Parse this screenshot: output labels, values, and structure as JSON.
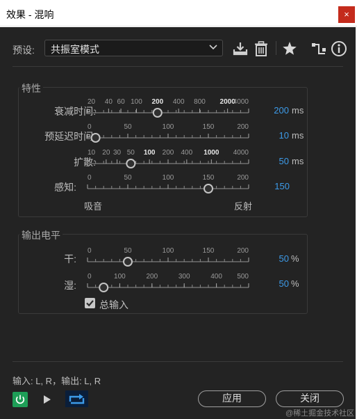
{
  "window": {
    "title": "效果 - 混响",
    "close_glyph": "×"
  },
  "preset": {
    "label": "预设:",
    "value": "共振室模式"
  },
  "toolbar": {
    "icons": [
      "download-icon",
      "trash-icon",
      "star-icon",
      "routing-icon",
      "info-icon"
    ]
  },
  "characteristics": {
    "title": "特性",
    "sliders": [
      {
        "label": "衰减时间:",
        "value": "200",
        "unit": "ms",
        "scale": "log",
        "min": 20,
        "max": 4000,
        "current": 200,
        "ticks": [
          {
            "v": 20,
            "t": "20",
            "h": false
          },
          {
            "v": 40,
            "t": "40",
            "h": false
          },
          {
            "v": 60,
            "t": "60",
            "h": false
          },
          {
            "v": 100,
            "t": "100",
            "h": false
          },
          {
            "v": 200,
            "t": "200",
            "h": true
          },
          {
            "v": 400,
            "t": "400",
            "h": false
          },
          {
            "v": 800,
            "t": "800",
            "h": false
          },
          {
            "v": 2000,
            "t": "2000",
            "h": true
          },
          {
            "v": 4000,
            "t": "4000",
            "h": false
          }
        ]
      },
      {
        "label": "预延迟时间:",
        "value": "10",
        "unit": "ms",
        "scale": "linear",
        "min": 0,
        "max": 200,
        "current": 10,
        "ticks": [
          {
            "v": 0,
            "t": "0",
            "h": false
          },
          {
            "v": 50,
            "t": "50",
            "h": false
          },
          {
            "v": 100,
            "t": "100",
            "h": false
          },
          {
            "v": 150,
            "t": "150",
            "h": false
          },
          {
            "v": 200,
            "t": "200",
            "h": false
          }
        ]
      },
      {
        "label": "扩散:",
        "value": "50",
        "unit": "ms",
        "scale": "log",
        "min": 10,
        "max": 4000,
        "current": 50,
        "ticks": [
          {
            "v": 10,
            "t": "10",
            "h": false
          },
          {
            "v": 20,
            "t": "20",
            "h": false
          },
          {
            "v": 30,
            "t": "30",
            "h": false
          },
          {
            "v": 50,
            "t": "50",
            "h": false
          },
          {
            "v": 100,
            "t": "100",
            "h": true
          },
          {
            "v": 200,
            "t": "200",
            "h": false
          },
          {
            "v": 400,
            "t": "400",
            "h": false
          },
          {
            "v": 1000,
            "t": "1000",
            "h": true
          },
          {
            "v": 4000,
            "t": "4000",
            "h": false
          }
        ]
      },
      {
        "label": "感知:",
        "value": "150",
        "unit": "",
        "scale": "linear",
        "min": 0,
        "max": 200,
        "current": 150,
        "ticks": [
          {
            "v": 0,
            "t": "0",
            "h": false
          },
          {
            "v": 50,
            "t": "50",
            "h": false
          },
          {
            "v": 100,
            "t": "100",
            "h": false
          },
          {
            "v": 150,
            "t": "150",
            "h": false
          },
          {
            "v": 200,
            "t": "200",
            "h": false
          }
        ]
      }
    ],
    "perception_left": "吸音",
    "perception_right": "反射"
  },
  "output": {
    "title": "输出电平",
    "sliders": [
      {
        "label": "干:",
        "value": "50",
        "unit": "%",
        "scale": "linear",
        "min": 0,
        "max": 200,
        "current": 50,
        "ticks": [
          {
            "v": 0,
            "t": "0",
            "h": false
          },
          {
            "v": 50,
            "t": "50",
            "h": false
          },
          {
            "v": 100,
            "t": "100",
            "h": false
          },
          {
            "v": 150,
            "t": "150",
            "h": false
          },
          {
            "v": 200,
            "t": "200",
            "h": false
          }
        ]
      },
      {
        "label": "湿:",
        "value": "50",
        "unit": "%",
        "scale": "linear",
        "min": 0,
        "max": 500,
        "current": 50,
        "ticks": [
          {
            "v": 0,
            "t": "0",
            "h": false
          },
          {
            "v": 100,
            "t": "100",
            "h": false
          },
          {
            "v": 200,
            "t": "200",
            "h": false
          },
          {
            "v": 300,
            "t": "300",
            "h": false
          },
          {
            "v": 400,
            "t": "400",
            "h": false
          },
          {
            "v": 500,
            "t": "500",
            "h": false
          }
        ]
      }
    ],
    "sum_input_label": "总输入",
    "sum_input_checked": true
  },
  "footer": {
    "io": "输入: L, R，输出: L, R",
    "apply": "应用",
    "close": "关闭",
    "watermark": "@稀土掘金技术社区"
  },
  "colors": {
    "accent": "#3d9be9",
    "power": "#1e9e57",
    "background": "#232323"
  }
}
